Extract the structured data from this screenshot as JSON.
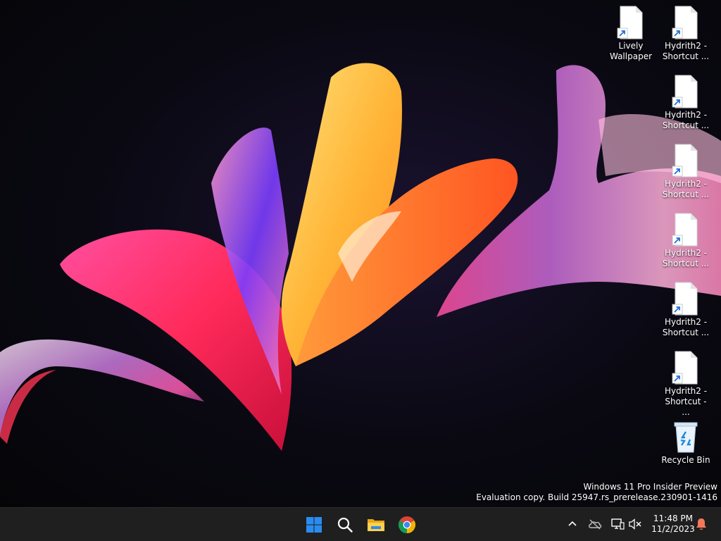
{
  "desktop": {
    "icons": [
      {
        "name": "lively-wallpaper-shortcut",
        "line1": "Lively",
        "line2": "Wallpaper",
        "type": "shortcut"
      },
      {
        "name": "hydrith2-shortcut-1",
        "line1": "Hydrith2 -",
        "line2": "Shortcut ...",
        "type": "shortcut"
      },
      {
        "name": "hydrith2-shortcut-2",
        "line1": "Hydrith2 -",
        "line2": "Shortcut ...",
        "type": "shortcut"
      },
      {
        "name": "hydrith2-shortcut-3",
        "line1": "Hydrith2 -",
        "line2": "Shortcut ...",
        "type": "shortcut"
      },
      {
        "name": "hydrith2-shortcut-4",
        "line1": "Hydrith2 -",
        "line2": "Shortcut ...",
        "type": "shortcut"
      },
      {
        "name": "hydrith2-shortcut-5",
        "line1": "Hydrith2 -",
        "line2": "Shortcut ...",
        "type": "shortcut"
      },
      {
        "name": "hydrith2-shortcut-6",
        "line1": "Hydrith2 -",
        "line2": "Shortcut - ...",
        "type": "shortcut"
      },
      {
        "name": "recycle-bin",
        "line1": "Recycle Bin",
        "line2": "",
        "type": "recycle-bin"
      }
    ],
    "watermark": {
      "line1": "Windows 11 Pro Insider Preview",
      "line2": "Evaluation copy. Build 25947.rs_prerelease.230901-1416"
    }
  },
  "taskbar": {
    "pinned": [
      {
        "name": "start-button",
        "icon": "windows-logo-icon"
      },
      {
        "name": "search-button",
        "icon": "search-icon"
      },
      {
        "name": "file-explorer-button",
        "icon": "folder-icon"
      },
      {
        "name": "chrome-button",
        "icon": "chrome-icon"
      }
    ],
    "tray": {
      "icons": [
        "chevron-up-icon",
        "onedrive-offline-icon",
        "network-icon",
        "volume-muted-icon"
      ],
      "time": "11:48 PM",
      "date": "11/2/2023",
      "notification_icon": "notification-bell-icon"
    },
    "colors": {
      "background": "#1f1f1f",
      "windows_blue": "#2a8cf0",
      "bell_orange": "#f5775a"
    }
  }
}
